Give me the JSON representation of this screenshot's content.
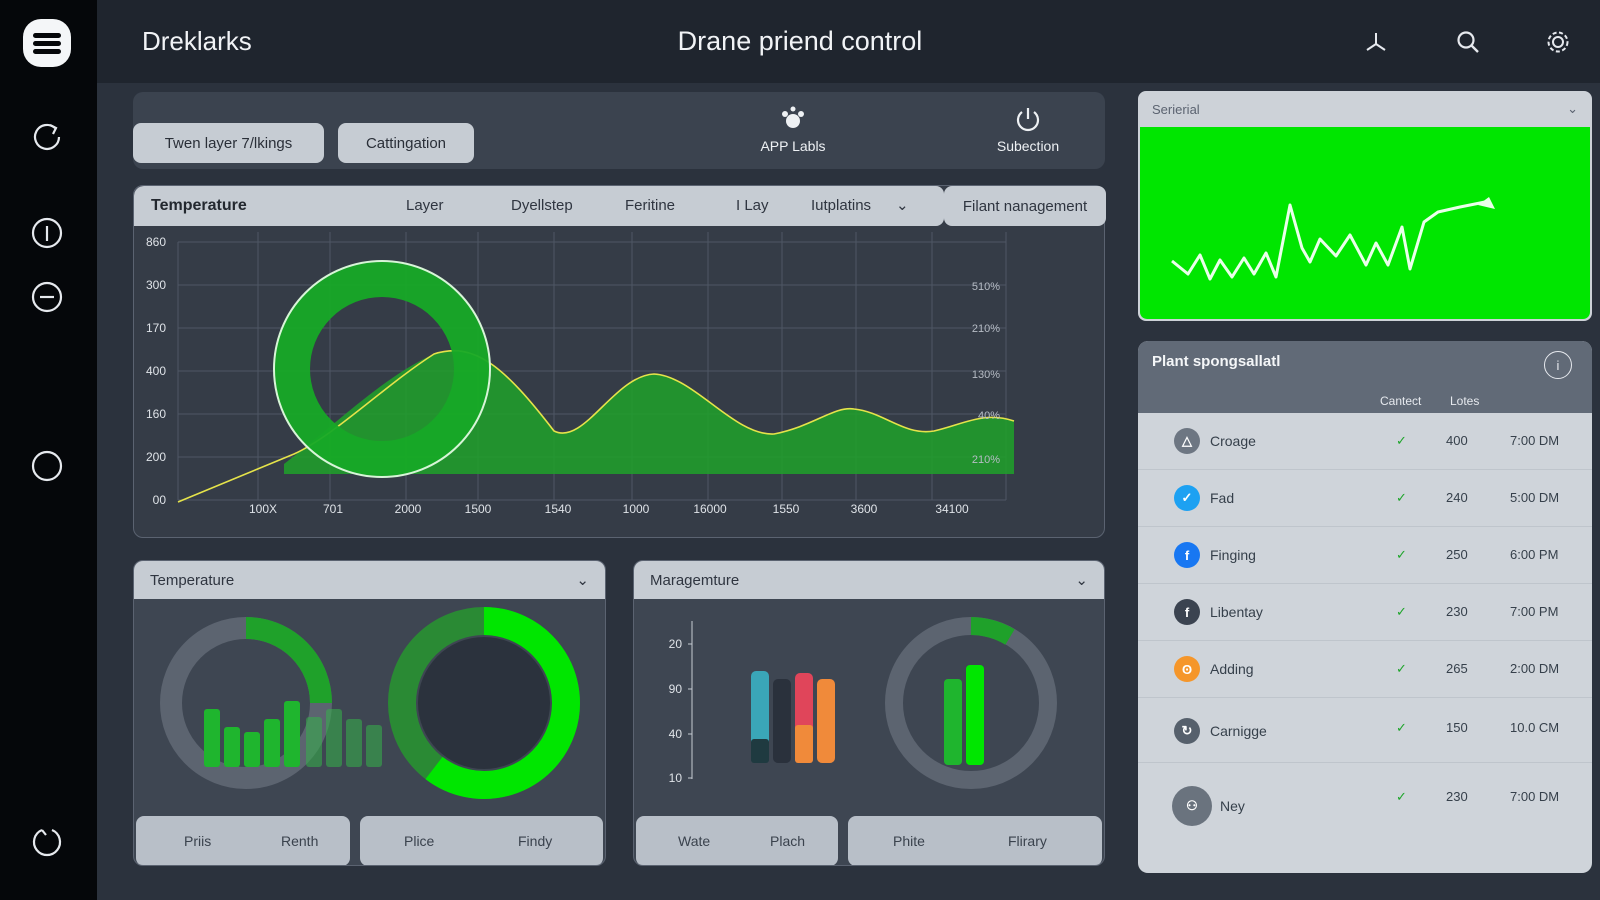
{
  "app": {
    "brand": "Dreklarks",
    "title": "Drane priend control"
  },
  "toolbar": {
    "button_1": "Twen layer 7/lkings",
    "button_2": "Cattingation",
    "tool_1": "APP Labls",
    "tool_2": "Subection",
    "filant_button": "Filant nanagement"
  },
  "main_chart": {
    "tabs": [
      "Temperature",
      "Layer",
      "Dyellstep",
      "Feritine",
      "I Lay",
      "Iutplatins"
    ],
    "y_ticks_left": [
      "860",
      "300",
      "170",
      "400",
      "160",
      "200",
      "00"
    ],
    "y_ticks_right": [
      "510%",
      "210%",
      "130%",
      "40%",
      "210%"
    ],
    "x_ticks": [
      "100X",
      "701",
      "2000",
      "1500",
      "1540",
      "1000",
      "16000",
      "1550",
      "3600",
      "34100"
    ]
  },
  "serial_panel": {
    "label": "Serierial"
  },
  "plant_panel": {
    "title": "Plant spongsallatl",
    "col_contact": "Cantect",
    "col_lotes": "Lotes",
    "rows": [
      {
        "name": "Croage",
        "count": "400",
        "time": "7:00 DM",
        "color": "#6d7682"
      },
      {
        "name": "Fad",
        "count": "240",
        "time": "5:00 DM",
        "color": "#1da1f2"
      },
      {
        "name": "Finging",
        "count": "250",
        "time": "6:00 PM",
        "color": "#1877f2"
      },
      {
        "name": "Libentay",
        "count": "230",
        "time": "7:00 PM",
        "color": "#3b4350"
      },
      {
        "name": "Adding",
        "count": "265",
        "time": "2:00 DM",
        "color": "#f5962a"
      },
      {
        "name": "Carnigge",
        "count": "150",
        "time": "10.0 CM",
        "color": "#56606c"
      },
      {
        "name": "Ney",
        "count": "230",
        "time": "7:00 DM",
        "color": "#6a737e"
      }
    ]
  },
  "bottom_left": {
    "title": "Temperature",
    "pills": [
      [
        "Priis",
        "Renth"
      ],
      [
        "Plice",
        "Findy"
      ]
    ]
  },
  "bottom_right": {
    "title": "Maragemture",
    "y_ticks": [
      "20",
      "90",
      "40",
      "10"
    ],
    "pills": [
      [
        "Wate",
        "Plach"
      ],
      [
        "Phite",
        "Flirary"
      ]
    ]
  },
  "colors": {
    "accent_green": "#00e600",
    "chart_green": "#22c42a"
  }
}
